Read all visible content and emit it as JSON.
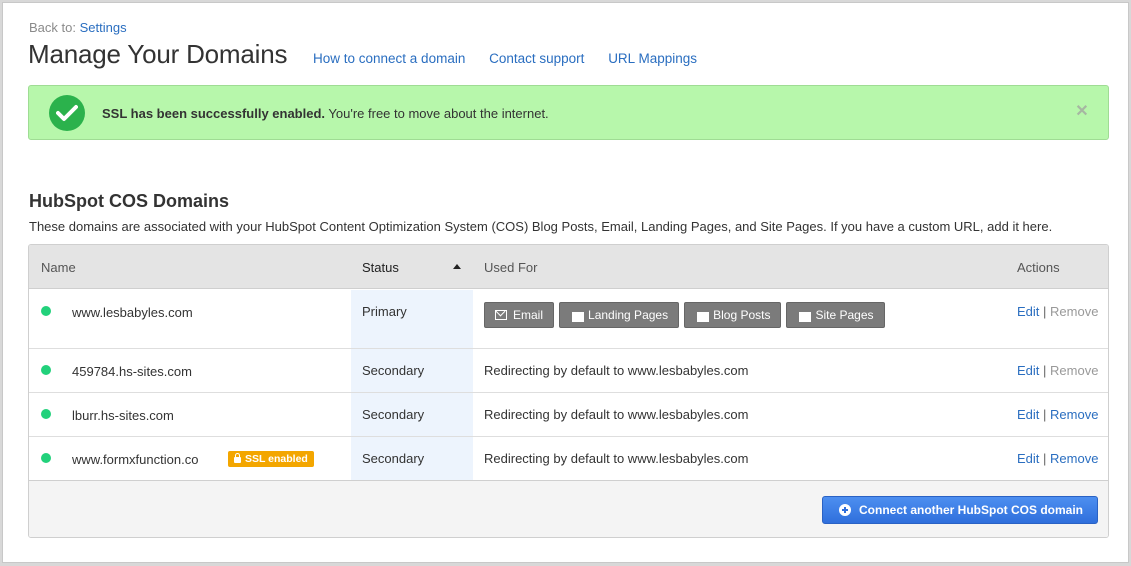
{
  "breadcrumb": {
    "prefix": "Back to:",
    "link": "Settings"
  },
  "page_title": "Manage Your Domains",
  "header_links": [
    "How to connect a domain",
    "Contact support",
    "URL Mappings"
  ],
  "alert": {
    "bold": "SSL has been successfully enabled.",
    "text": " You're free to move about the internet.",
    "close_icon": "close-icon"
  },
  "section": {
    "title": "HubSpot COS Domains",
    "description": "These domains are associated with your HubSpot Content Optimization System (COS) Blog Posts, Email, Landing Pages, and Site Pages. If you have a custom URL, add it here."
  },
  "table": {
    "columns": {
      "name": "Name",
      "status": "Status",
      "used_for": "Used For",
      "actions": "Actions"
    },
    "sort": {
      "column": "Status",
      "direction": "ascending"
    },
    "tags": [
      "Email",
      "Landing Pages",
      "Blog Posts",
      "Site Pages"
    ],
    "rows": [
      {
        "name": "www.lesbabyles.com",
        "status": "Primary",
        "used_for": "",
        "edit": "Edit",
        "separator": "|",
        "remove": "Remove",
        "remove_enabled": false
      },
      {
        "name": "459784.hs-sites.com",
        "status": "Secondary",
        "used_for": "Redirecting by default to www.lesbabyles.com",
        "edit": "Edit",
        "separator": "|",
        "remove": "Remove",
        "remove_enabled": false
      },
      {
        "name": "lburr.hs-sites.com",
        "status": "Secondary",
        "used_for": "Redirecting by default to www.lesbabyles.com",
        "edit": "Edit",
        "separator": "|",
        "remove": "Remove",
        "remove_enabled": true
      },
      {
        "name": "www.formxfunction.co",
        "badge": "SSL enabled",
        "status": "Secondary",
        "used_for": "Redirecting by default to www.lesbabyles.com",
        "edit": "Edit",
        "separator": "|",
        "remove": "Remove",
        "remove_enabled": true
      }
    ],
    "connect_button": "Connect another HubSpot COS domain"
  },
  "colors": {
    "alert_bg": "#b7f7ab",
    "status_dot": "#22d17b",
    "link": "#2a6ec0",
    "badge": "#f3a600",
    "primary_button": "#2f6fdc"
  }
}
